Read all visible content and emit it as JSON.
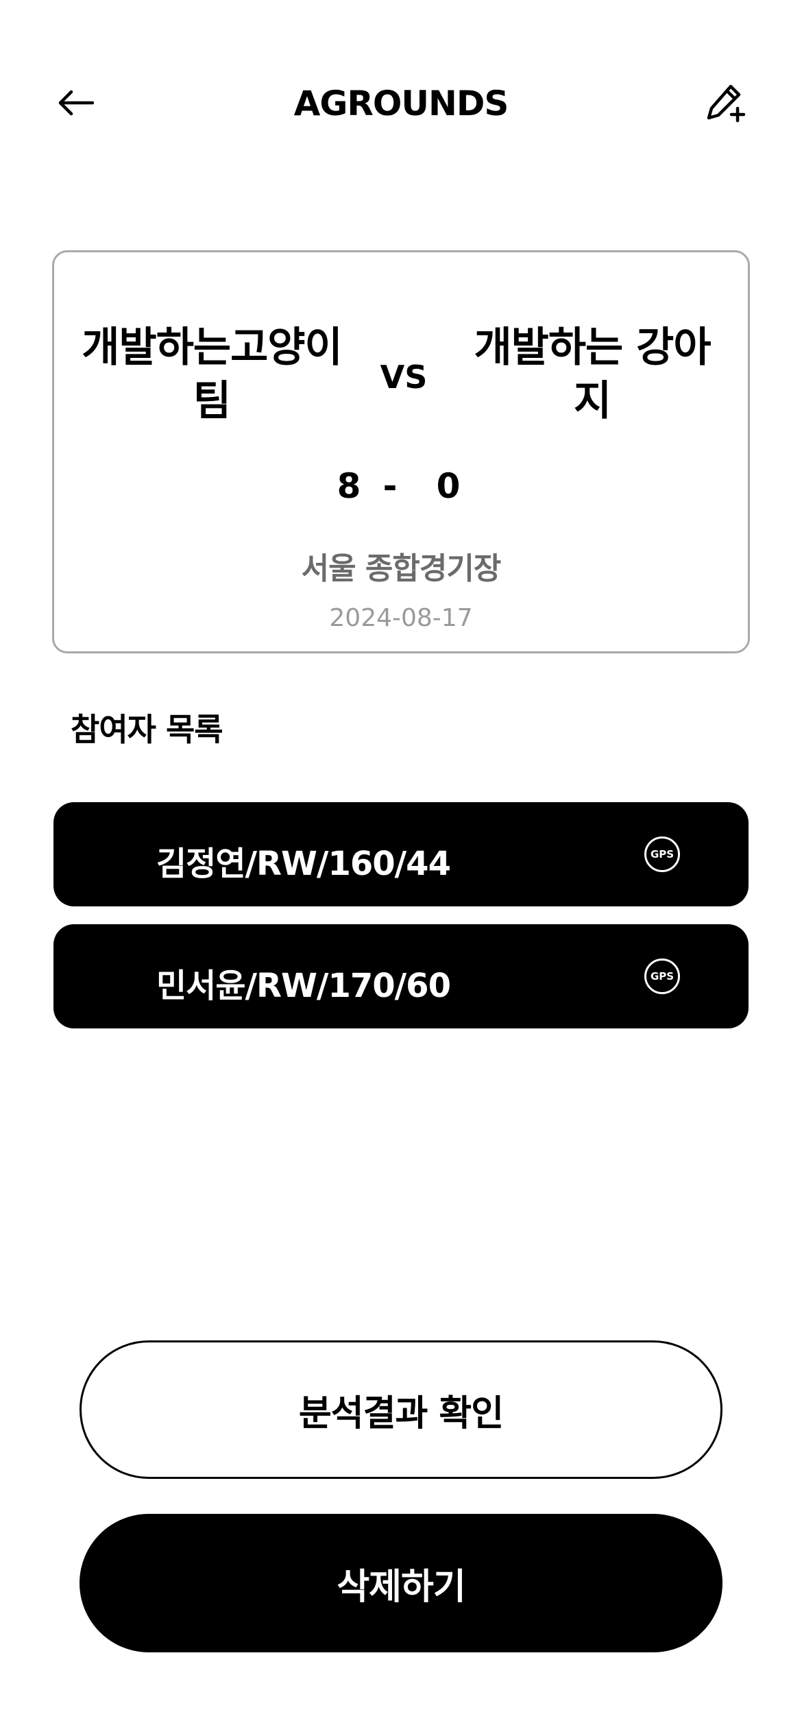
{
  "header": {
    "back_icon": "arrow-left-icon",
    "title": "AGROUNDS",
    "edit_icon": "pencil-plus-icon"
  },
  "match": {
    "home_team": "개발하는고양이팀",
    "vs": "VS",
    "away_team": "개발하는 강아지",
    "home_score": "8",
    "separator": "-",
    "away_score": "0",
    "venue": "서울 종합경기장",
    "date": "2024-08-17"
  },
  "participants": {
    "title": "참여자 목록",
    "items": [
      {
        "label": "김정연/RW/160/44",
        "icon": "gps-icon",
        "icon_text": "GPS"
      },
      {
        "label": "민서윤/RW/170/60",
        "icon": "gps-icon",
        "icon_text": "GPS"
      }
    ]
  },
  "actions": {
    "analysis_label": "분석결과 확인",
    "delete_label": "삭제하기"
  },
  "colors": {
    "primary": "#000000",
    "background": "#ffffff",
    "card_border": "#a9a9a9",
    "venue_text": "#6b6b6b",
    "date_text": "#9a9a9a"
  }
}
